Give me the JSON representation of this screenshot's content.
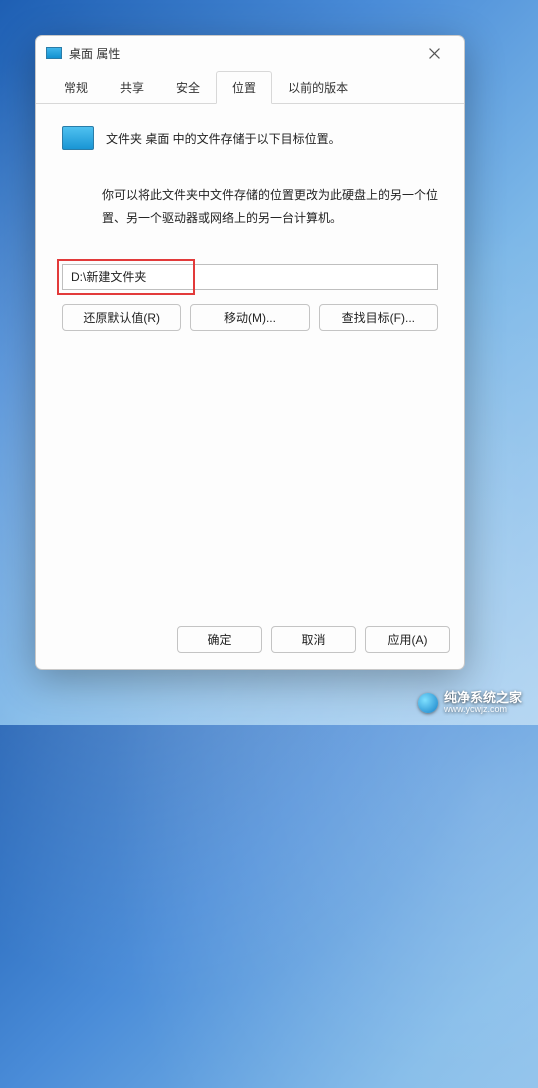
{
  "dialog": {
    "title": "桌面 属性",
    "tabs": {
      "general": "常规",
      "sharing": "共享",
      "security": "安全",
      "location": "位置",
      "previous": "以前的版本"
    },
    "info_line": "文件夹 桌面 中的文件存储于以下目标位置。",
    "description": "你可以将此文件夹中文件存储的位置更改为此硬盘上的另一个位置、另一个驱动器或网络上的另一台计算机。",
    "path_value": "D:\\新建文件夹",
    "buttons": {
      "restore": "还原默认值(R)",
      "move": "移动(M)...",
      "find": "查找目标(F)...",
      "ok": "确定",
      "cancel": "取消",
      "apply": "应用(A)"
    }
  },
  "watermark": {
    "name": "纯净系统之家",
    "url": "www.ycwjz.com"
  }
}
